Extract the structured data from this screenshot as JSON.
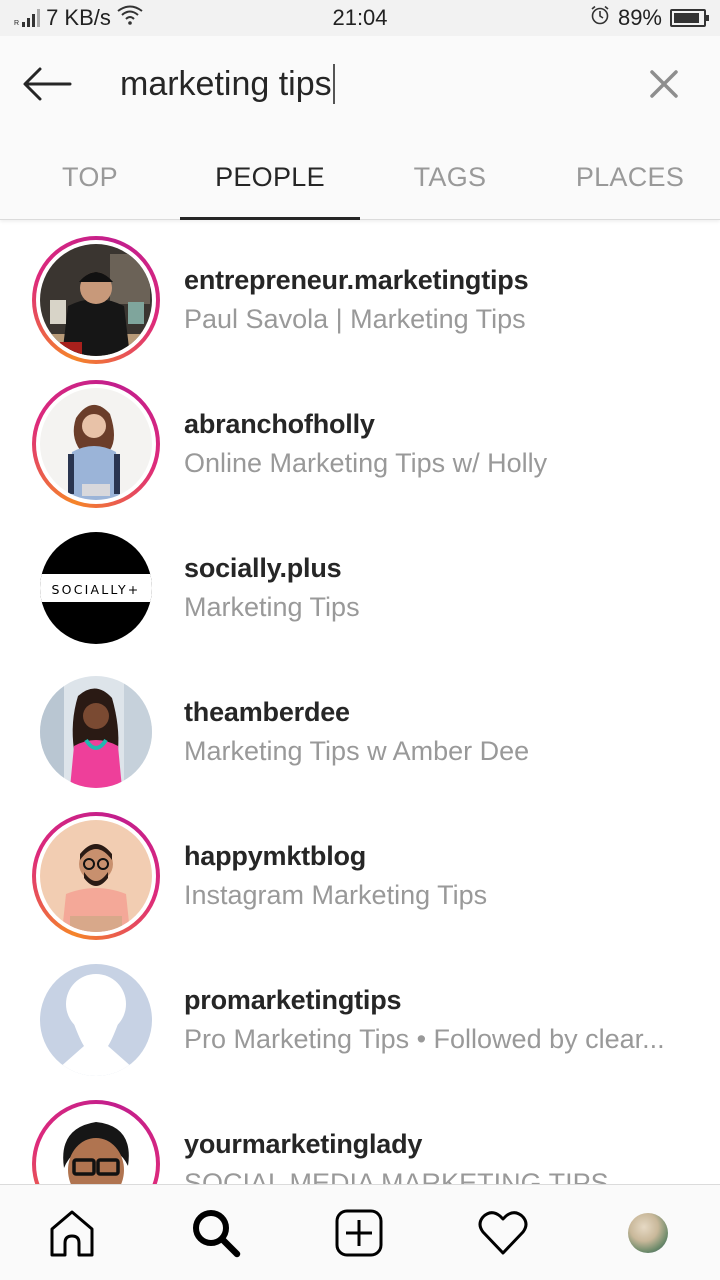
{
  "status_bar": {
    "network_speed": "7 KB/s",
    "time": "21:04",
    "battery_percent": "89%",
    "battery_level": 0.89,
    "icons": [
      "signal-icon",
      "wifi-icon",
      "alarm-icon",
      "battery-icon"
    ]
  },
  "search": {
    "query": "marketing tips",
    "back_icon": "arrow-left-icon",
    "clear_icon": "close-icon"
  },
  "tabs": [
    {
      "label": "TOP",
      "active": false
    },
    {
      "label": "PEOPLE",
      "active": true
    },
    {
      "label": "TAGS",
      "active": false
    },
    {
      "label": "PLACES",
      "active": false
    }
  ],
  "results": [
    {
      "username": "entrepreneur.marketingtips",
      "full_name": "Paul Savola | Marketing Tips",
      "story_ring": true
    },
    {
      "username": "abranchofholly",
      "full_name": "Online Marketing Tips w/ Holly",
      "story_ring": true
    },
    {
      "username": "socially.plus",
      "full_name": "Marketing Tips",
      "story_ring": false,
      "avatar_text": "SOCIALLY+"
    },
    {
      "username": "theamberdee",
      "full_name": "Marketing Tips w Amber Dee",
      "story_ring": false
    },
    {
      "username": "happymktblog",
      "full_name": "Instagram Marketing Tips",
      "story_ring": true
    },
    {
      "username": "promarketingtips",
      "full_name": "Pro Marketing Tips • Followed by clear...",
      "story_ring": false
    },
    {
      "username": "yourmarketinglady",
      "full_name": "SOCIAL MEDIA MARKETING TIPS",
      "story_ring": true
    }
  ],
  "bottom_nav": [
    {
      "name": "home",
      "icon": "home-icon",
      "active": false
    },
    {
      "name": "search",
      "icon": "search-icon",
      "active": true
    },
    {
      "name": "new-post",
      "icon": "plus-square-icon",
      "active": false
    },
    {
      "name": "activity",
      "icon": "heart-icon",
      "active": false
    },
    {
      "name": "profile",
      "icon": "profile-avatar",
      "active": false
    }
  ],
  "colors": {
    "text_primary": "#262626",
    "text_secondary": "#999999",
    "ring_start": "#f58529",
    "ring_end": "#c21e8d",
    "placeholder_avatar": "#c7d2e4"
  }
}
